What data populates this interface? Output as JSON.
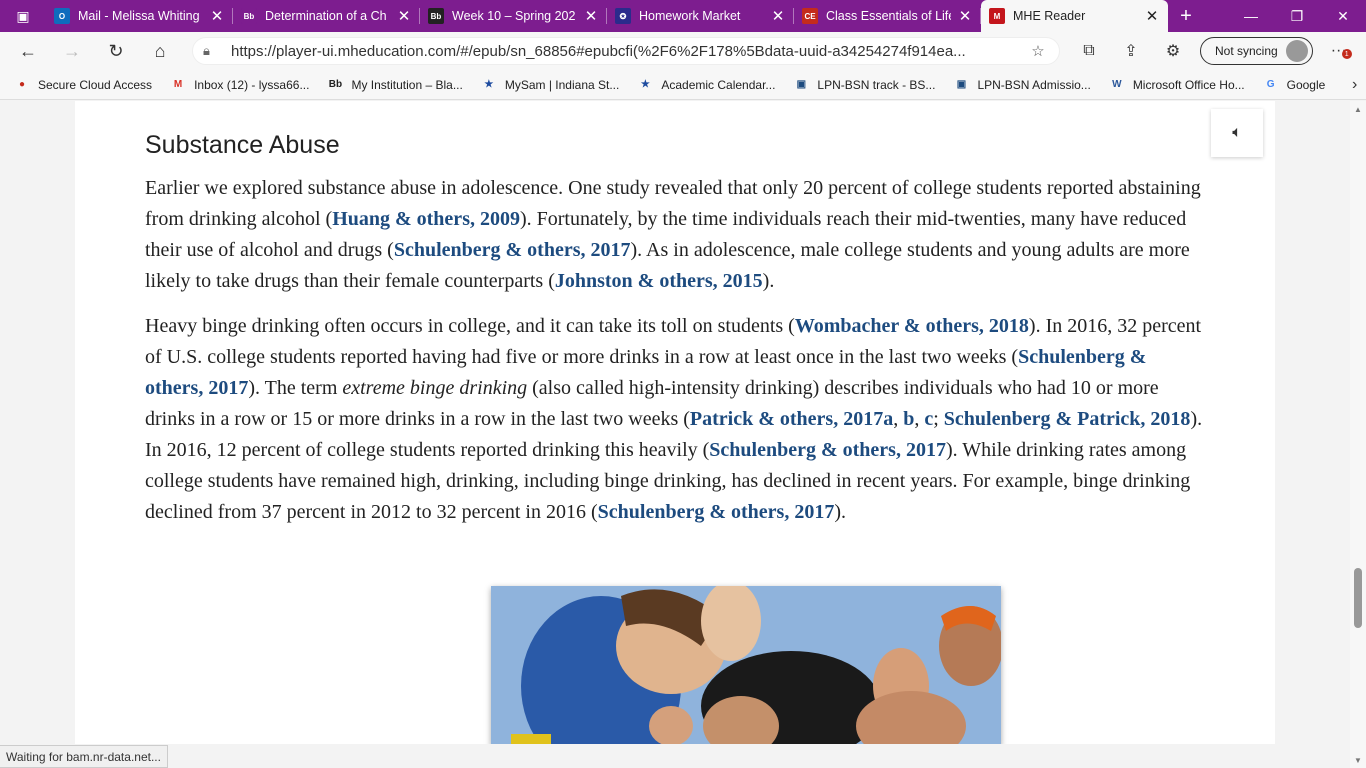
{
  "tabs": [
    {
      "title": "Mail - Melissa Whiting",
      "icon": "outlook-icon",
      "color": "#0f6cbd",
      "glyph": "O"
    },
    {
      "title": "Determination of a Ch",
      "icon": "blackboard-icon",
      "color": "#7d1d8f",
      "glyph": "Bb"
    },
    {
      "title": "Week 10 – Spring 202",
      "icon": "blackboard-icon",
      "color": "#222222",
      "glyph": "Bb"
    },
    {
      "title": "Homework Market",
      "icon": "homework-market-icon",
      "color": "#2b2b8c",
      "glyph": "✪"
    },
    {
      "title": "Class Essentials of Life",
      "icon": "class-essentials-icon",
      "color": "#c42b1c",
      "glyph": "CE"
    },
    {
      "title": "MHE Reader",
      "icon": "mhe-icon",
      "color": "#c4161c",
      "glyph": "M",
      "active": true
    }
  ],
  "address": {
    "url": "https://player-ui.mheducation.com/#/epub/sn_68856#epubcfi(%2F6%2F178%5Bdata-uuid-a34254274f914ea..."
  },
  "profile": {
    "sync_label": "Not syncing"
  },
  "notifications_badge": "1",
  "bookmarks": [
    {
      "label": "Secure Cloud Access",
      "icon": "secure-cloud-icon",
      "color": "#c42b1c",
      "glyph": "●"
    },
    {
      "label": "Inbox (12) - lyssa66...",
      "icon": "gmail-icon",
      "color": "#d93025",
      "glyph": "M"
    },
    {
      "label": "My Institution – Bla...",
      "icon": "blackboard-icon",
      "color": "#222222",
      "glyph": "Bb"
    },
    {
      "label": "MySam | Indiana St...",
      "icon": "mysam-icon",
      "color": "#1d4b9f",
      "glyph": "★"
    },
    {
      "label": "Academic Calendar...",
      "icon": "calendar-icon",
      "color": "#1d4b9f",
      "glyph": "★"
    },
    {
      "label": "LPN-BSN track - BS...",
      "icon": "lpn-icon",
      "color": "#1d4b7f",
      "glyph": "▣"
    },
    {
      "label": "LPN-BSN Admissio...",
      "icon": "lpn-icon",
      "color": "#1d4b7f",
      "glyph": "▣"
    },
    {
      "label": "Microsoft Office Ho...",
      "icon": "word-icon",
      "color": "#2b579a",
      "glyph": "W"
    },
    {
      "label": "Google",
      "icon": "google-icon",
      "color": "#4285f4",
      "glyph": "G"
    }
  ],
  "article": {
    "heading": "Substance Abuse",
    "p1": [
      {
        "t": "Earlier we explored substance abuse in adolescence. One study revealed that only 20 percent of college students reported abstaining from drinking alcohol ("
      },
      {
        "t": "Huang & others, 2009",
        "link": true
      },
      {
        "t": "). Fortunately, by the time individuals reach their mid-twenties, many have reduced their use of alcohol and drugs ("
      },
      {
        "t": "Schulenberg & others, 2017",
        "link": true
      },
      {
        "t": "). As in adolescence, male college students and young adults are more likely to take drugs than their female counterparts ("
      },
      {
        "t": "Johnston & others, 2015",
        "link": true
      },
      {
        "t": ")."
      }
    ],
    "p2": [
      {
        "t": "Heavy binge drinking often occurs in college, and it can take its toll on students ("
      },
      {
        "t": "Wombacher & others, 2018",
        "link": true
      },
      {
        "t": "). In 2016, 32 percent of U.S. college students reported having had five or more drinks in a row at least once in the last two weeks ("
      },
      {
        "t": "Schulenberg & others, 2017",
        "link": true
      },
      {
        "t": "). The term "
      },
      {
        "t": "extreme binge drinking",
        "em": true
      },
      {
        "t": " (also called high-intensity drinking) describes individuals who had 10 or more drinks in a row or 15 or more drinks in a row in the last two weeks ("
      },
      {
        "t": "Patrick & others, 2017a",
        "link": true
      },
      {
        "t": ", "
      },
      {
        "t": "b",
        "link": true
      },
      {
        "t": ", "
      },
      {
        "t": "c",
        "link": true
      },
      {
        "t": "; "
      },
      {
        "t": "Schulenberg & Patrick, 2018",
        "link": true
      },
      {
        "t": "). In 2016, 12 percent of college students reported drinking this heavily ("
      },
      {
        "t": "Schulenberg & others, 2017",
        "link": true
      },
      {
        "t": "). While drinking rates among college students have remained high, drinking, including binge drinking, has declined in recent years. For example, binge drinking declined from 37 percent in 2012 to 32 percent in 2016 ("
      },
      {
        "t": "Schulenberg & others, 2017",
        "link": true
      },
      {
        "t": ")."
      }
    ]
  },
  "status_text": "Waiting for bam.nr-data.net..."
}
